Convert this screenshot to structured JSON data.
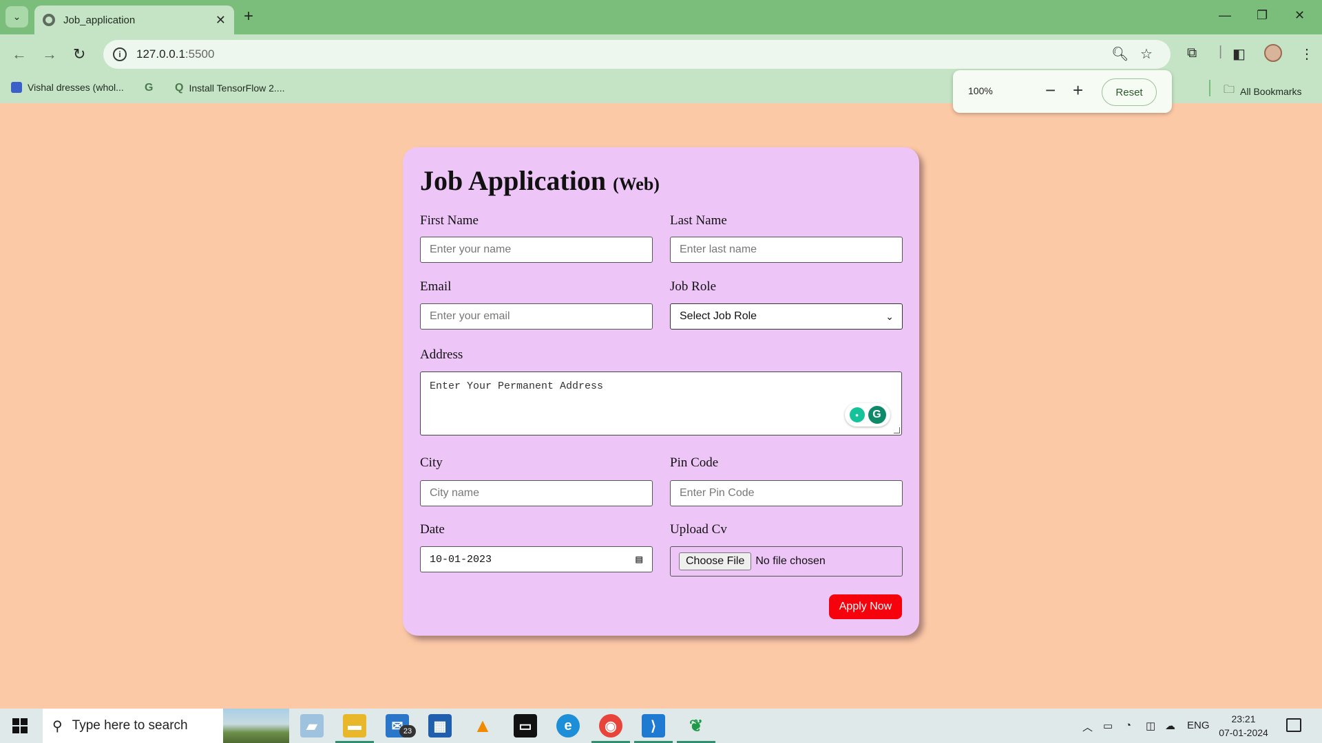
{
  "browser": {
    "tab_title": "Job_application",
    "url_host": "127.0.0.1",
    "url_port": ":5500",
    "bookmarks": [
      {
        "label": "Vishal dresses (whol..."
      },
      {
        "label": ""
      },
      {
        "label": "Install TensorFlow 2...."
      }
    ],
    "all_bookmarks_label": "All Bookmarks",
    "zoom": {
      "level": "100%",
      "minus": "−",
      "plus": "+",
      "reset_label": "Reset"
    }
  },
  "form": {
    "title": "Job Application",
    "subtitle": "(Web)",
    "first_name": {
      "label": "First Name",
      "placeholder": "Enter your name"
    },
    "last_name": {
      "label": "Last Name",
      "placeholder": "Enter last name"
    },
    "email": {
      "label": "Email",
      "placeholder": "Enter your email"
    },
    "job_role": {
      "label": "Job Role",
      "selected": "Select Job Role"
    },
    "address": {
      "label": "Address",
      "placeholder": "Enter Your Permanent Address"
    },
    "city": {
      "label": "City",
      "placeholder": "City name"
    },
    "pin_code": {
      "label": "Pin Code",
      "placeholder": "Enter Pin Code"
    },
    "date": {
      "label": "Date",
      "value": "10-01-2023"
    },
    "upload_cv": {
      "label": "Upload Cv",
      "button": "Choose File",
      "status": "No file chosen"
    },
    "submit_label": "Apply Now",
    "submit_color": "#f5020c"
  },
  "taskbar": {
    "search_placeholder": "Type here to search",
    "mail_badge": "23",
    "language": "ENG",
    "time": "23:21",
    "date": "07-01-2024"
  }
}
